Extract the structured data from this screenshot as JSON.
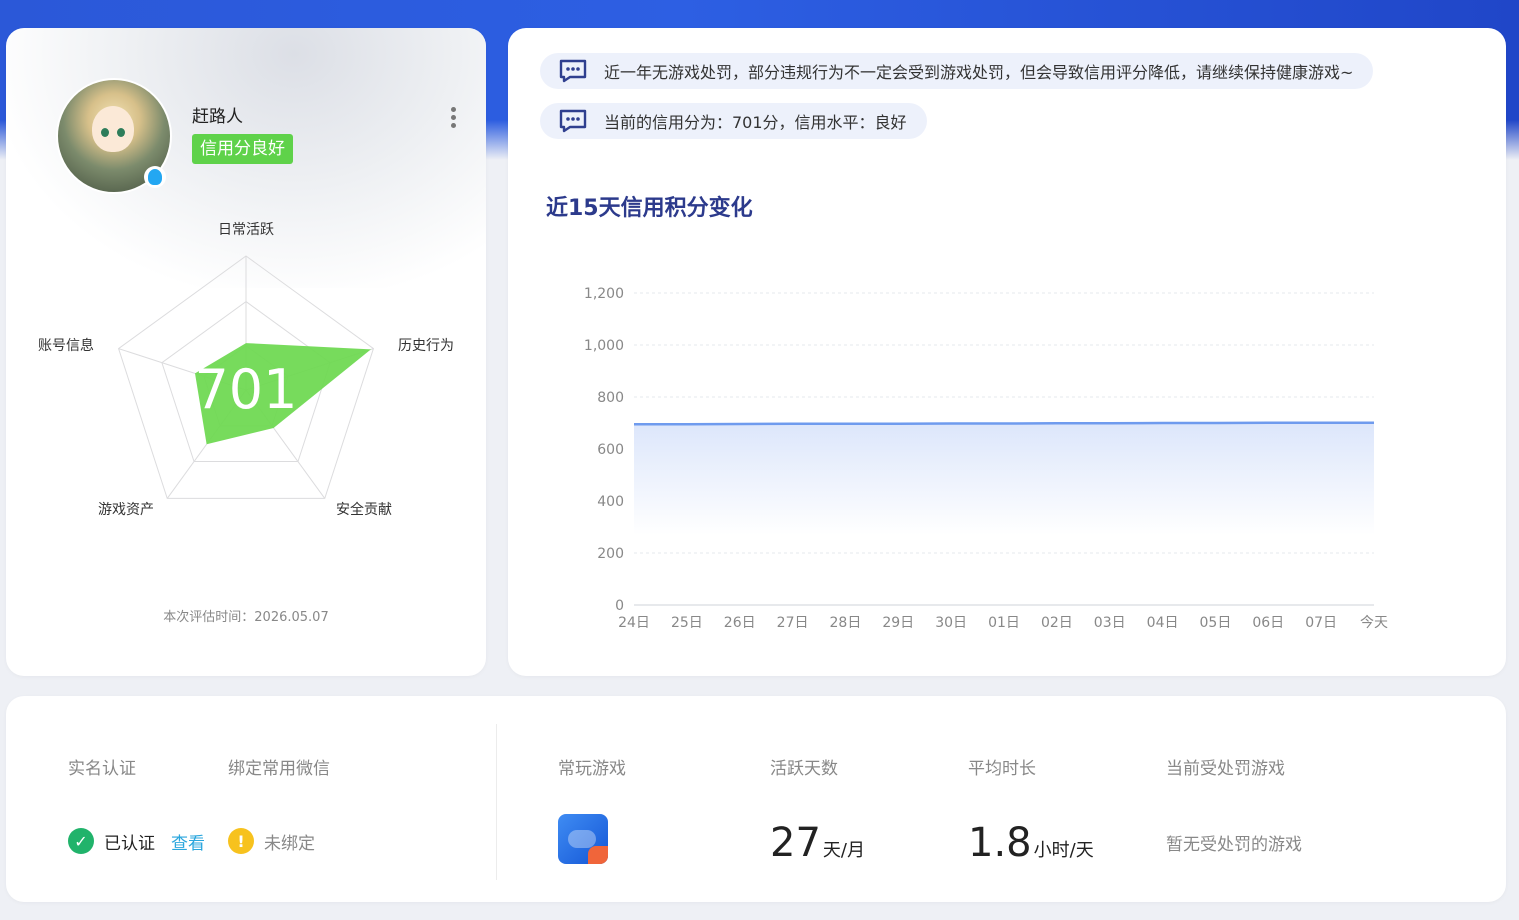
{
  "profile": {
    "username": "赶路人",
    "credit_tag": "信用分良好",
    "score": "701",
    "eval_time": "本次评估时间：2026.05.07",
    "radar": {
      "labels": [
        "日常活跃",
        "历史行为",
        "安全贡献",
        "游戏资产",
        "账号信息"
      ],
      "values": [
        0.35,
        0.98,
        0.35,
        0.5,
        0.4
      ]
    }
  },
  "notices": [
    "近一年无游戏处罚，部分违规行为不一定会受到游戏处罚，但会导致信用评分降低，请继续保持健康游戏~",
    "当前的信用分为：701分，信用水平：良好"
  ],
  "chart_data": {
    "type": "area",
    "title": "近15天信用积分变化",
    "categories": [
      "24日",
      "25日",
      "26日",
      "27日",
      "28日",
      "29日",
      "30日",
      "01日",
      "02日",
      "03日",
      "04日",
      "05日",
      "06日",
      "07日",
      "今天"
    ],
    "values": [
      695,
      695,
      696,
      697,
      697,
      697,
      698,
      698,
      699,
      699,
      700,
      700,
      701,
      701,
      701
    ],
    "ylim": [
      0,
      1200
    ],
    "yticks": [
      "0",
      "200",
      "400",
      "600",
      "800",
      "1,000",
      "1,200"
    ],
    "xlabel": "",
    "ylabel": "",
    "grid": true,
    "colors": {
      "line": "#6f9bee",
      "fill": "#dce6fb"
    }
  },
  "stats": {
    "realname_label": "实名认证",
    "wechat_label": "绑定常用微信",
    "realname_status": "已认证",
    "view_link": "查看",
    "wechat_status": "未绑定",
    "game_label": "常玩游戏",
    "active_label": "活跃天数",
    "active_value": "27",
    "active_unit": "天/月",
    "avg_label": "平均时长",
    "avg_value": "1.8",
    "avg_unit": "小时/天",
    "penalty_label": "当前受处罚游戏",
    "penalty_value": "暂无受处罚的游戏"
  }
}
